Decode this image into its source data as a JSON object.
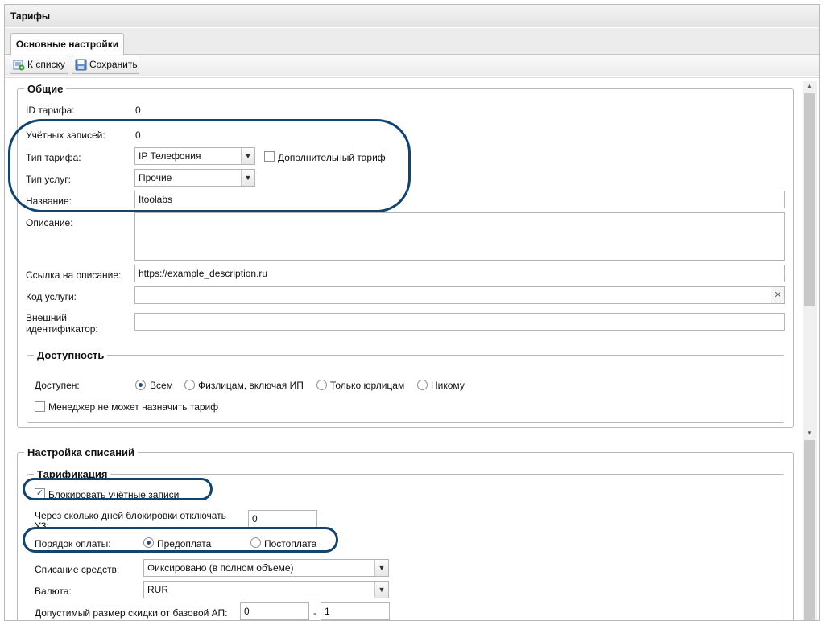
{
  "window": {
    "title": "Тарифы"
  },
  "tabs": [
    {
      "label": "Основные настройки"
    }
  ],
  "toolbar": {
    "back_label": "К списку",
    "save_label": "Сохранить"
  },
  "general": {
    "legend": "Общие",
    "id_label": "ID тарифа:",
    "id_value": "0",
    "accounts_label": "Учётных записей:",
    "accounts_value": "0",
    "tariff_type_label": "Тип тарифа:",
    "tariff_type_value": "IP Телефония",
    "additional_label": "Дополнительный тариф",
    "service_type_label": "Тип услуг:",
    "service_type_value": "Прочие",
    "name_label": "Название:",
    "name_value": "Itoolabs",
    "description_label": "Описание:",
    "description_value": "",
    "link_label": "Ссылка на описание:",
    "link_value": "https://example_description.ru",
    "service_code_label": "Код услуги:",
    "service_code_value": "",
    "external_id_label_1": "Внешний",
    "external_id_label_2": "идентификатор:",
    "external_id_value": ""
  },
  "availability": {
    "legend": "Доступность",
    "available_label": "Доступен:",
    "options": [
      "Всем",
      "Физлицам, включая ИП",
      "Только юрлицам",
      "Никому"
    ],
    "selected": "Всем",
    "manager_label": "Менеджер не может назначить тариф"
  },
  "charges": {
    "legend": "Настройка списаний",
    "tarification_legend": "Тарификация",
    "block_accounts_label": "Блокировать учётные записи",
    "block_accounts_checked": true,
    "days_label_1": "Через сколько дней блокировки отключать",
    "days_label_2": "УЗ:",
    "days_value": "0",
    "payment_order_label": "Порядок оплаты:",
    "payment_options": [
      "Предоплата",
      "Постоплата"
    ],
    "payment_selected": "Предоплата",
    "write_off_label": "Списание средств:",
    "write_off_value": "Фиксировано (в полном объеме)",
    "currency_label": "Валюта:",
    "currency_value": "RUR",
    "discount_label": "Допустимый размер скидки от базовой АП:",
    "discount_from": "0",
    "discount_sep": "-",
    "discount_to": "1"
  },
  "colors": {
    "highlight": "#12446e",
    "radio_dot": "#2a4e7a",
    "check": "#1a4f9c"
  }
}
